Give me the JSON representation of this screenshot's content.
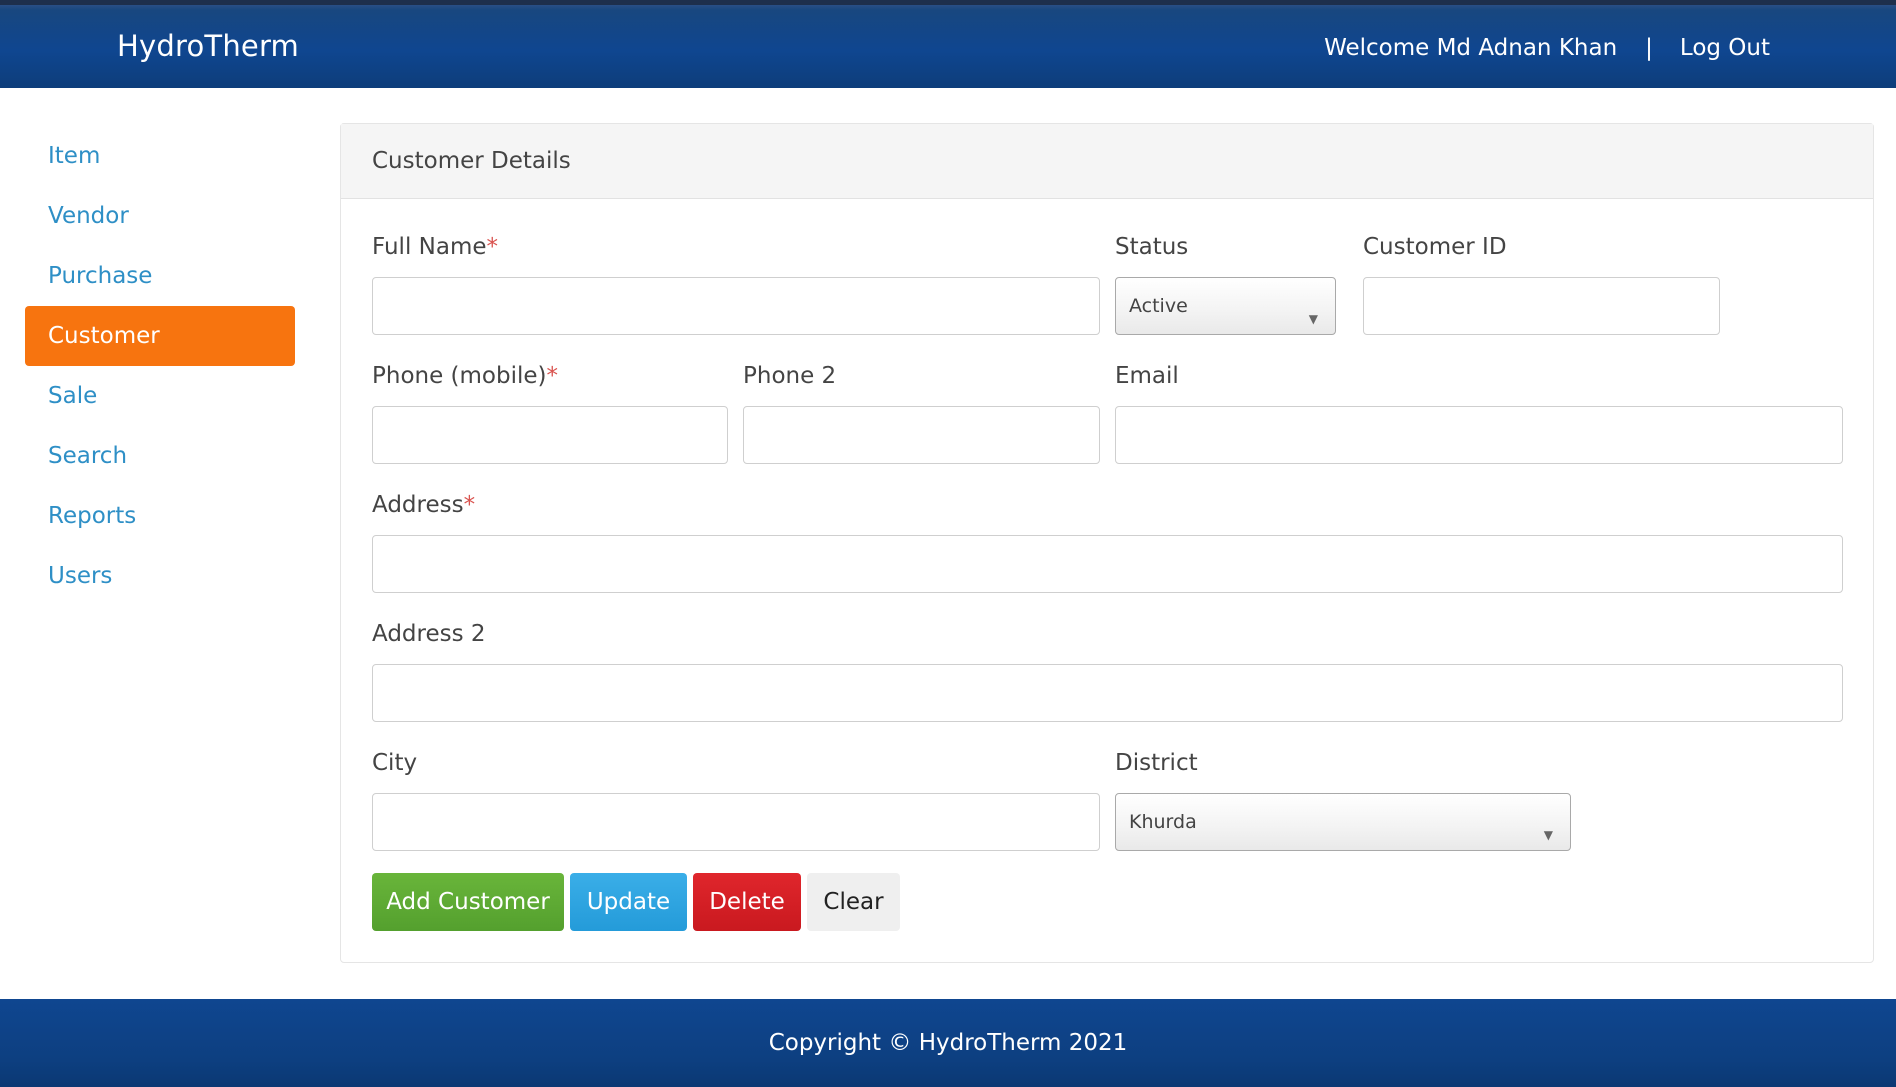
{
  "header": {
    "brand": "HydroTherm",
    "welcome": "Welcome Md Adnan Khan",
    "separator": "|",
    "logout": "Log Out"
  },
  "sidebar": {
    "items": [
      {
        "label": "Item"
      },
      {
        "label": "Vendor"
      },
      {
        "label": "Purchase"
      },
      {
        "label": "Customer",
        "active": true
      },
      {
        "label": "Sale"
      },
      {
        "label": "Search"
      },
      {
        "label": "Reports"
      },
      {
        "label": "Users"
      }
    ]
  },
  "panel": {
    "title": "Customer Details"
  },
  "form": {
    "full_name": {
      "label": "Full Name",
      "required_mark": "*",
      "value": ""
    },
    "status": {
      "label": "Status",
      "selected": "Active"
    },
    "customer_id": {
      "label": "Customer ID",
      "value": ""
    },
    "phone_mobile": {
      "label": "Phone (mobile)",
      "required_mark": "*",
      "value": ""
    },
    "phone2": {
      "label": "Phone 2",
      "value": ""
    },
    "email": {
      "label": "Email",
      "value": ""
    },
    "address": {
      "label": "Address",
      "required_mark": "*",
      "value": ""
    },
    "address2": {
      "label": "Address 2",
      "value": ""
    },
    "city": {
      "label": "City",
      "value": ""
    },
    "district": {
      "label": "District",
      "selected": "Khurda"
    }
  },
  "buttons": {
    "add": "Add Customer",
    "update": "Update",
    "delete": "Delete",
    "clear": "Clear"
  },
  "footer": {
    "copyright": "Copyright © HydroTherm 2021"
  },
  "colors": {
    "header_blue": "#0f4690",
    "accent_orange": "#f7740f",
    "link_blue": "#2e8fc6",
    "add_green": "#5cab33",
    "update_blue": "#2ea4e0",
    "delete_red": "#d51f25"
  }
}
